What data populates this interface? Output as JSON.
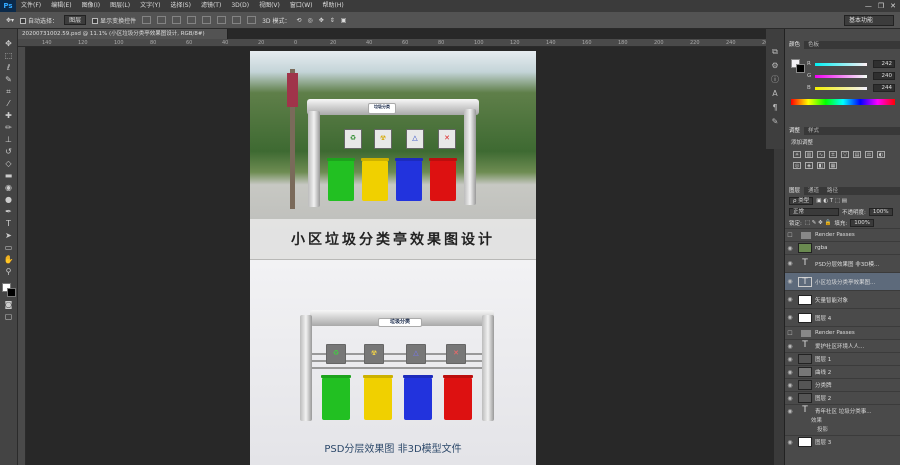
{
  "app": {
    "logo": "Ps",
    "window_controls": [
      "—",
      "❐",
      "✕"
    ]
  },
  "menu": [
    "文件(F)",
    "编辑(E)",
    "图像(I)",
    "图层(L)",
    "文字(Y)",
    "选择(S)",
    "滤镜(T)",
    "3D(D)",
    "视图(V)",
    "窗口(W)",
    "帮助(H)"
  ],
  "options": {
    "auto_select": "自动选择：",
    "auto_select_value": "图层",
    "show_transform": "显示变换控件",
    "mode_3d": "3D 模式：",
    "workspace": "基本功能"
  },
  "document": {
    "tab": "20200731002.59.psd @ 11.1% (小区垃圾分类亭效果图设计, RGB/8#)",
    "title": "小区垃圾分类亭效果图设计",
    "caption": "PSD分层效果图 非3D模型文件",
    "sign_text": "垃圾分类",
    "signs": [
      "♻",
      "☢",
      "△",
      "✕"
    ],
    "sign_colors": [
      "#2a8a2a",
      "#d4a700",
      "#1f3fc4",
      "#d22"
    ],
    "bins": [
      "#22c022",
      "#f0d000",
      "#2233dd",
      "#dd1111"
    ]
  },
  "ruler": [
    "140",
    "120",
    "100",
    "80",
    "60",
    "40",
    "20",
    "0",
    "20",
    "40",
    "60",
    "80",
    "100",
    "120",
    "140",
    "160",
    "180",
    "200",
    "220",
    "240",
    "260",
    "280"
  ],
  "color_panel": {
    "tabs": [
      "颜色",
      "色板"
    ],
    "r_label": "R",
    "r_value": "242",
    "g_label": "G",
    "g_value": "240",
    "b_label": "B",
    "b_value": "244"
  },
  "adjustments": {
    "tabs": [
      "调整",
      "样式"
    ],
    "title": "添加调整"
  },
  "layers_panel": {
    "tabs": [
      "图层",
      "通道",
      "路径"
    ],
    "filter": "ρ 类型",
    "blend_mode": "正常",
    "opacity_label": "不透明度:",
    "opacity": "100%",
    "lock_label": "锁定:",
    "fill_label": "填充:",
    "fill": "100%",
    "layers": [
      {
        "name": "Render Passes",
        "kind": "folder"
      },
      {
        "name": "rgba",
        "kind": "image"
      },
      {
        "name": "PSD分层效果图 非3D模...",
        "kind": "text"
      },
      {
        "name": "小区垃圾分类亭效果图...",
        "kind": "text",
        "selected": true
      },
      {
        "name": "矢量智能对象",
        "kind": "image"
      },
      {
        "name": "图层 4",
        "kind": "image"
      },
      {
        "name": "Render Passes",
        "kind": "folder"
      },
      {
        "name": "爱护社区环境人人...",
        "kind": "text"
      },
      {
        "name": "图层 1",
        "kind": "image"
      },
      {
        "name": "曲线 2",
        "kind": "adjust"
      },
      {
        "name": "分类牌",
        "kind": "image"
      },
      {
        "name": "图层 2",
        "kind": "image"
      },
      {
        "name": "青年社区 垃圾分类事...",
        "kind": "text",
        "fx": true
      },
      {
        "name": "图层 3",
        "kind": "image"
      }
    ],
    "effects_label": "效果",
    "shadow_label": "投影"
  }
}
